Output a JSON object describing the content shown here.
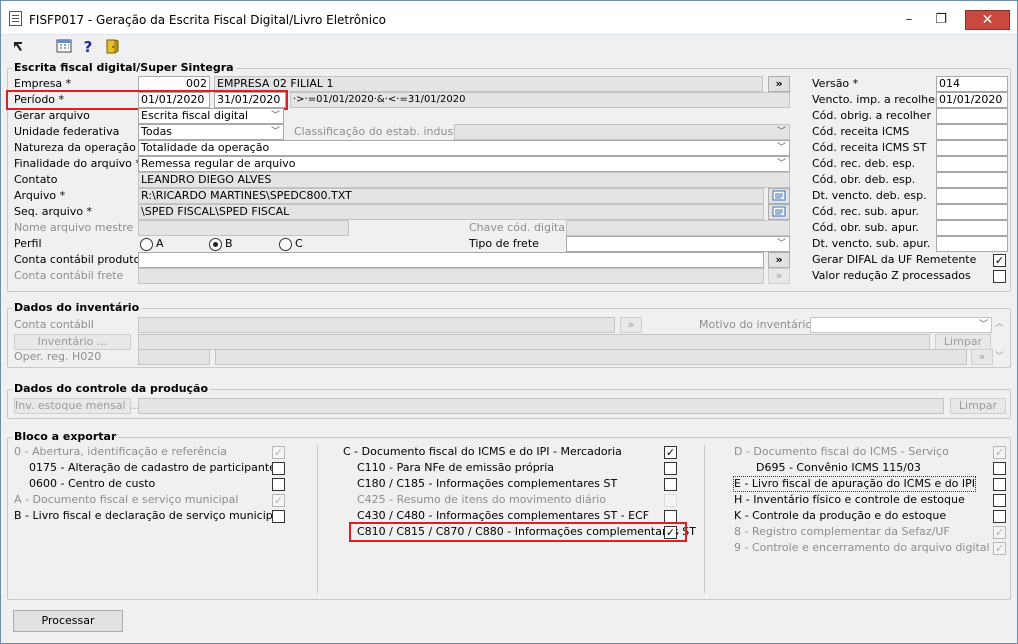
{
  "window": {
    "title": "FISFP017 - Geração da Escrita Fiscal Digital/Livro Eletrônico",
    "minimize": "–",
    "restore": "❐",
    "close": "✕"
  },
  "toolbar": {
    "icons": [
      "cursor-icon",
      "calculator-icon",
      "help-icon",
      "exit-door-icon"
    ],
    "help_glyph": "?"
  },
  "escrita": {
    "title": "Escrita fiscal digital/Super Sintegra",
    "empresa_label": "Empresa *",
    "empresa_code": "002",
    "empresa_name": "EMPRESA 02 FILIAL 1",
    "lookup_glyph": "»",
    "periodo_label": "Período *",
    "periodo_inicio": "01/01/2020",
    "periodo_fim": "31/01/2020",
    "periodo_expr": "·>·=01/01/2020·&·<·=31/01/2020",
    "gerar_label": "Gerar arquivo",
    "gerar_value": "Escrita fiscal digital",
    "uf_label": "Unidade federativa",
    "uf_value": "Todas",
    "classif_label": "Classificação do estab. indust.",
    "natureza_label": "Natureza da operação *",
    "natureza_value": "Totalidade da operação",
    "finalidade_label": "Finalidade do arquivo *",
    "finalidade_value": "Remessa regular de arquivo",
    "contato_label": "Contato",
    "contato_value": "LEANDRO DIEGO ALVES",
    "arquivo_label": "Arquivo *",
    "arquivo_value": "R:\\RICARDO MARTINES\\SPEDC800.TXT",
    "seq_label": "Seq. arquivo *",
    "seq_value": "\\SPED FISCAL\\SPED FISCAL",
    "nome_mestre_label": "Nome arquivo mestre",
    "chave_label": "Chave cód. digital",
    "perfil_label": "Perfil",
    "perfil_a": "A",
    "perfil_b": "B",
    "perfil_c": "C",
    "frete_label": "Tipo de frete",
    "conta_prod_label": "Conta contábil produto",
    "conta_frete_label": "Conta contábil frete",
    "versao_label": "Versão *",
    "versao_value": "014",
    "vencto_label": "Vencto. imp. a recolher *",
    "vencto_value": "01/01/2020",
    "cod_obrig_label": "Cód. obrig. a recolher",
    "cod_rec_icms_label": "Cód. receita ICMS",
    "cod_rec_icms_st_label": "Cód. receita ICMS ST",
    "cod_rec_deb_label": "Cód. rec. deb. esp.",
    "cod_obr_deb_label": "Cód. obr. deb. esp.",
    "dt_deb_label": "Dt. vencto. deb. esp.",
    "cod_rec_sub_label": "Cód. rec. sub. apur.",
    "cod_obr_sub_label": "Cód. obr. sub. apur.",
    "dt_sub_label": "Dt. vencto. sub. apur.",
    "difal_label": "Gerar DIFAL da UF Remetente",
    "reducao_label": "Valor redução Z processados"
  },
  "inventario": {
    "title": "Dados do inventário",
    "conta_label": "Conta contábil",
    "inventario_btn": "Inventário ...",
    "motivo_label": "Motivo do inventário",
    "limpar": "Limpar",
    "oper_label": "Oper. reg. H020"
  },
  "producao": {
    "title": "Dados do controle da produção",
    "inv_btn": "Inv. estoque mensal ...",
    "limpar": "Limpar"
  },
  "bloco": {
    "title": "Bloco a exportar",
    "col1": [
      {
        "label": "0 - Abertura, identificação e referência",
        "checked": true,
        "disabled": true
      },
      {
        "label": "0175 - Alteração de cadastro de participante",
        "checked": false,
        "disabled": false
      },
      {
        "label": "0600 - Centro de custo",
        "checked": false,
        "disabled": false
      },
      {
        "label": "A - Documento fiscal e serviço municipal",
        "checked": true,
        "disabled": true
      },
      {
        "label": "B - Livro fiscal e declaração de serviço municipal",
        "checked": false,
        "disabled": false
      }
    ],
    "col2": [
      {
        "label": "C - Documento fiscal do ICMS e do IPI - Mercadoria",
        "checked": true,
        "disabled": false
      },
      {
        "label": "C110 - Para NFe de emissão própria",
        "checked": false,
        "disabled": false
      },
      {
        "label": "C180 / C185 - Informações complementares ST",
        "checked": false,
        "disabled": false
      },
      {
        "label": "C425 - Resumo de itens do movimento diário",
        "checked": false,
        "disabled": true
      },
      {
        "label": "C430 / C480 - Informações complementares ST - ECF",
        "checked": false,
        "disabled": false
      },
      {
        "label": "C810 / C815 / C870 / C880 - Informações complementares ST",
        "checked": true,
        "disabled": false
      }
    ],
    "col3": [
      {
        "label": "D - Documento fiscal do ICMS - Serviço",
        "checked": true,
        "disabled": true
      },
      {
        "label": "D695 - Convênio ICMS 115/03",
        "checked": false,
        "disabled": false
      },
      {
        "label": "E - Livro fiscal de apuração do ICMS e do IPI",
        "checked": false,
        "disabled": false
      },
      {
        "label": "H - Inventário físico e controle de estoque",
        "checked": false,
        "disabled": false
      },
      {
        "label": "K - Controle da produção e do estoque",
        "checked": false,
        "disabled": false
      },
      {
        "label": "8 - Registro complementar da Sefaz/UF",
        "checked": true,
        "disabled": true
      },
      {
        "label": "9 - Controle e encerramento do arquivo digital",
        "checked": true,
        "disabled": true
      }
    ]
  },
  "footer": {
    "processar": "Processar"
  },
  "colors": {
    "highlight": "#e02020",
    "titlebar": "#ffffff",
    "close": "#c9483f"
  }
}
